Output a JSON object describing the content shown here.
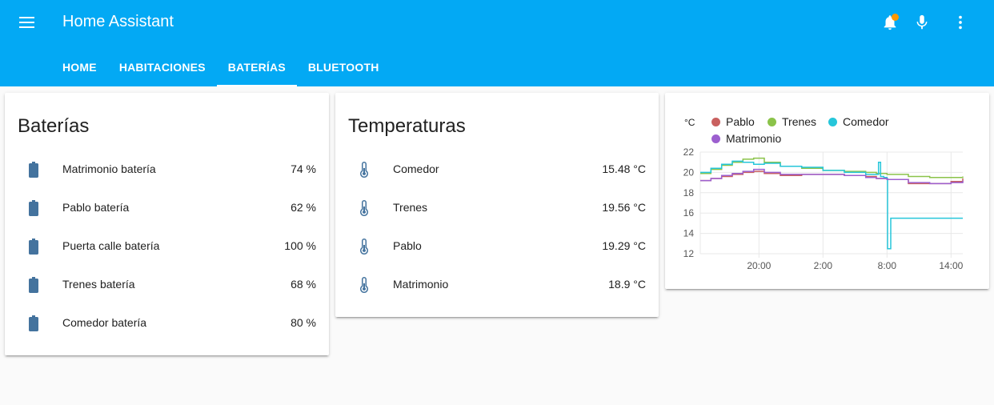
{
  "header": {
    "title": "Home Assistant",
    "tabs": [
      {
        "label": "HOME"
      },
      {
        "label": "HABITACIONES"
      },
      {
        "label": "BATERÍAS"
      },
      {
        "label": "BLUETOOTH"
      }
    ],
    "active_tab": "BATERÍAS",
    "icons": [
      "menu-icon",
      "bell-icon",
      "microphone-icon",
      "more-vert-icon"
    ],
    "notification_dot_color": "#ff9800"
  },
  "colors": {
    "primary": "#03a9f4",
    "state_icon": "#44739e"
  },
  "batteries": {
    "title": "Baterías",
    "rows": [
      {
        "name": "Matrimonio batería",
        "state": "74 %"
      },
      {
        "name": "Pablo batería",
        "state": "62 %"
      },
      {
        "name": "Puerta calle batería",
        "state": "100 %"
      },
      {
        "name": "Trenes batería",
        "state": "68 %"
      },
      {
        "name": "Comedor batería",
        "state": "80 %"
      }
    ]
  },
  "temperatures": {
    "title": "Temperaturas",
    "rows": [
      {
        "name": "Comedor",
        "state": "15.48 °C"
      },
      {
        "name": "Trenes",
        "state": "19.56 °C"
      },
      {
        "name": "Pablo",
        "state": "19.29 °C"
      },
      {
        "name": "Matrimonio",
        "state": "18.9 °C"
      }
    ]
  },
  "chart_data": {
    "type": "line",
    "ylabel": "°C",
    "ylim": [
      12,
      22
    ],
    "y_ticks": [
      "22",
      "20",
      "18",
      "16",
      "14",
      "12"
    ],
    "x_ticks": [
      "20:00",
      "2:00",
      "8:00",
      "14:00"
    ],
    "x_tick_hours": [
      20,
      26,
      32,
      38
    ],
    "xlim": [
      14.5,
      39.1
    ],
    "grid": true,
    "legend_position": "top",
    "series": [
      {
        "name": "Pablo",
        "color": "#c9605f",
        "x": [
          14.5,
          15.5,
          16.5,
          17.5,
          18.5,
          19.5,
          20.5,
          22,
          24,
          26,
          28,
          30,
          31,
          32,
          34,
          36,
          38,
          39.1
        ],
        "values": [
          19.2,
          19.4,
          19.6,
          19.8,
          20.0,
          20.1,
          19.9,
          19.7,
          19.8,
          19.8,
          19.7,
          19.6,
          19.4,
          19.3,
          18.9,
          18.9,
          19.1,
          19.4
        ]
      },
      {
        "name": "Trenes",
        "color": "#8bc34a",
        "x": [
          14.5,
          15.5,
          16.5,
          17.5,
          18.5,
          19.5,
          20.5,
          22,
          24,
          26,
          28,
          30,
          31,
          32,
          34,
          36,
          38,
          39.1
        ],
        "values": [
          19.9,
          20.3,
          20.7,
          21.0,
          21.3,
          21.4,
          21.0,
          20.6,
          20.4,
          20.2,
          20.1,
          20.0,
          19.9,
          19.8,
          19.6,
          19.5,
          19.5,
          19.6
        ]
      },
      {
        "name": "Comedor",
        "color": "#26c6da",
        "x": [
          14.5,
          15.5,
          16.5,
          17.5,
          18.5,
          19.5,
          20.5,
          22,
          24,
          26,
          28,
          30,
          31,
          31.2,
          31.4,
          31.7,
          32,
          32.05,
          32.3,
          32.35,
          34,
          36,
          38,
          39.1
        ],
        "values": [
          20.0,
          20.4,
          20.8,
          21.1,
          21.0,
          20.8,
          20.9,
          20.6,
          20.5,
          20.2,
          20.0,
          19.8,
          19.8,
          21.0,
          19.6,
          19.5,
          19.4,
          12.5,
          12.5,
          15.5,
          15.5,
          15.5,
          15.5,
          15.5
        ]
      },
      {
        "name": "Matrimonio",
        "color": "#9c5fcf",
        "x": [
          14.5,
          15.5,
          16.5,
          17.5,
          18.5,
          19.5,
          20.5,
          22,
          24,
          26,
          28,
          30,
          31,
          32,
          34,
          36,
          38,
          39.1
        ],
        "values": [
          19.2,
          19.4,
          19.7,
          19.9,
          20.1,
          20.3,
          20.0,
          19.8,
          19.8,
          19.8,
          19.7,
          19.5,
          19.4,
          19.3,
          19.0,
          18.9,
          19.0,
          19.2
        ]
      }
    ]
  }
}
